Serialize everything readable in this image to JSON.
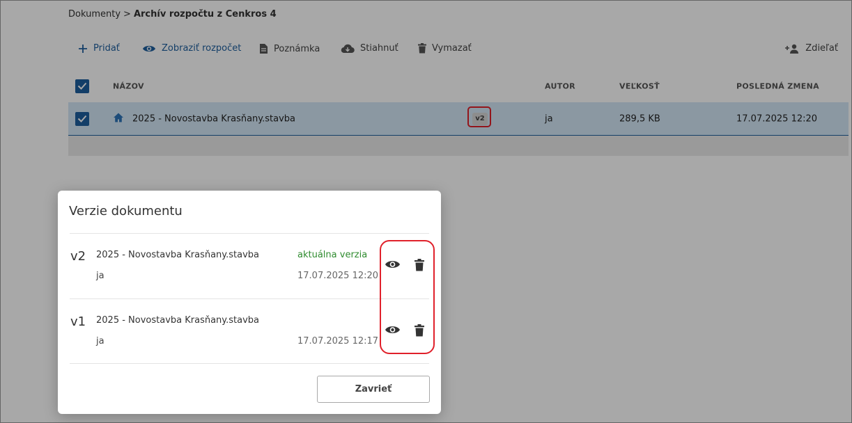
{
  "breadcrumb": {
    "root": "Dokumenty",
    "separator": ">",
    "current": "Archív rozpočtu z Cenkros 4"
  },
  "toolbar": {
    "add": "Pridať",
    "view_budget": "Zobraziť rozpočet",
    "note": "Poznámka",
    "download": "Stiahnuť",
    "delete": "Vymazať",
    "share": "Zdieľať"
  },
  "table": {
    "headers": {
      "name": "NÁZOV",
      "author": "AUTOR",
      "size": "VEĽKOSŤ",
      "modified": "POSLEDNÁ ZMENA"
    },
    "rows": [
      {
        "name": "2025 - Novostavba Krasňany.stavba",
        "version": "v2",
        "author": "ja",
        "size": "289,5 KB",
        "modified": "17.07.2025 12:20",
        "selected": true
      }
    ]
  },
  "modal": {
    "title": "Verzie dokumentu",
    "versions": [
      {
        "version": "v2",
        "name": "2025 - Novostavba Krasňany.stavba",
        "author": "ja",
        "status": "aktuálna verzia",
        "date": "17.07.2025 12:20"
      },
      {
        "version": "v1",
        "name": "2025 - Novostavba Krasňany.stavba",
        "author": "ja",
        "status": "",
        "date": "17.07.2025 12:17"
      }
    ],
    "close": "Zavrieť"
  },
  "colors": {
    "accent": "#1e5f9e",
    "selected_row": "#d4e7f6",
    "highlight": "#e0202a",
    "current_status": "#2e8b2e"
  },
  "icons": [
    "plus-icon",
    "eye-icon",
    "document-icon",
    "cloud-download-icon",
    "trash-icon",
    "add-person-icon",
    "home-icon",
    "checkbox-icon"
  ]
}
